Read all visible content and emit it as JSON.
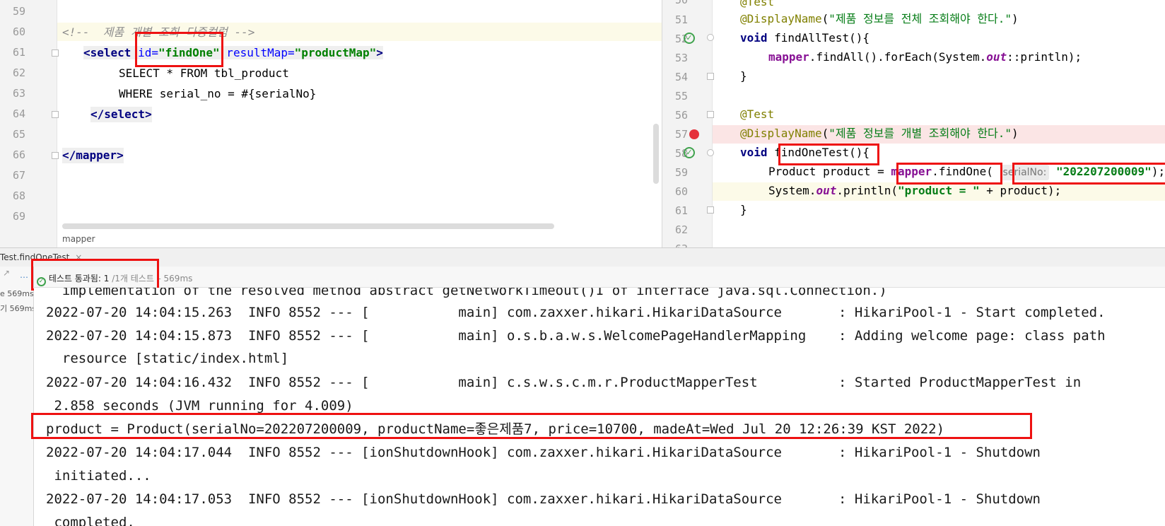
{
  "left_editor": {
    "breadcrumb": "mapper",
    "lines": [
      {
        "num": "59"
      },
      {
        "num": "60",
        "comment": "<!--  제품 개별 조회 다중컬럼 -->"
      },
      {
        "num": "61",
        "open": "<select ",
        "attr1": "id=",
        "val1": "\"findOne\"",
        "attr2": " resultMap=",
        "val2": "\"productMap\"",
        "close": ">"
      },
      {
        "num": "62",
        "text": "SELECT * FROM tbl_product"
      },
      {
        "num": "63",
        "text": "WHERE serial_no = #{serialNo}"
      },
      {
        "num": "64",
        "tag": "</select>"
      },
      {
        "num": "65"
      },
      {
        "num": "66",
        "tag": "</mapper>"
      },
      {
        "num": "67"
      },
      {
        "num": "68"
      },
      {
        "num": "69"
      }
    ]
  },
  "right_editor": {
    "lines": [
      {
        "num": "50",
        "annotation": "@Test"
      },
      {
        "num": "51",
        "annotation": "@DisplayName",
        "string": "\"제품 정보를 전체 조회해야 한다.\""
      },
      {
        "num": "52",
        "kw": "void",
        "rest": " findAllTest(){"
      },
      {
        "num": "53",
        "field": "mapper",
        "rest1": ".findAll().forEach(System.",
        "italic": "out",
        "rest2": "::println);"
      },
      {
        "num": "54",
        "text": "}"
      },
      {
        "num": "55"
      },
      {
        "num": "56",
        "annotation": "@Test"
      },
      {
        "num": "57",
        "annotation": "@DisplayName",
        "string": "\"제품 정보를 개별 조회해야 한다.\""
      },
      {
        "num": "58",
        "kw": "void",
        "rest": " findOneTest(){"
      },
      {
        "num": "59",
        "pre": "Product product = ",
        "field": "mapper",
        "rest1": ".findOne(",
        "hint": "serialNo:",
        "string": "\"202207200009\"",
        "rest2": ");"
      },
      {
        "num": "60",
        "pre": "System.",
        "italic": "out",
        "rest1": ".println(",
        "string": "\"product = \"",
        "rest2": " + product);"
      },
      {
        "num": "61",
        "text": "}"
      },
      {
        "num": "62"
      },
      {
        "num": "63"
      }
    ]
  },
  "run_panel": {
    "tab_label": "Test.findOneTest",
    "status_label": "테스트 통과됨:",
    "status_count": "1",
    "status_total": "/1개 테스트",
    "status_time": "– 569ms",
    "tree_times": [
      "e 569ms",
      "기 569ms"
    ],
    "console_lines": [
      "  implementation of the resolved method abstract getNetworkTimeout()I of interface java.sql.Connection.)",
      "2022-07-20 14:04:15.263  INFO 8552 --- [           main] com.zaxxer.hikari.HikariDataSource       : HikariPool-1 - Start completed.",
      "2022-07-20 14:04:15.873  INFO 8552 --- [           main] o.s.b.a.w.s.WelcomePageHandlerMapping    : Adding welcome page: class path",
      "  resource [static/index.html]",
      "2022-07-20 14:04:16.432  INFO 8552 --- [           main] c.s.w.s.c.m.r.ProductMapperTest          : Started ProductMapperTest in",
      " 2.858 seconds (JVM running for 4.009)",
      "product = Product(serialNo=202207200009, productName=좋은제품7, price=10700, madeAt=Wed Jul 20 12:26:39 KST 2022)",
      "2022-07-20 14:04:17.044  INFO 8552 --- [ionShutdownHook] com.zaxxer.hikari.HikariDataSource       : HikariPool-1 - Shutdown",
      " initiated...",
      "2022-07-20 14:04:17.053  INFO 8552 --- [ionShutdownHook] com.zaxxer.hikari.HikariDataSource       : HikariPool-1 - Shutdown",
      " completed."
    ]
  },
  "colors": {
    "highlight_box": "#ee1111",
    "pass_green": "#3fa34d",
    "breakpoint_red": "#e5323c"
  }
}
